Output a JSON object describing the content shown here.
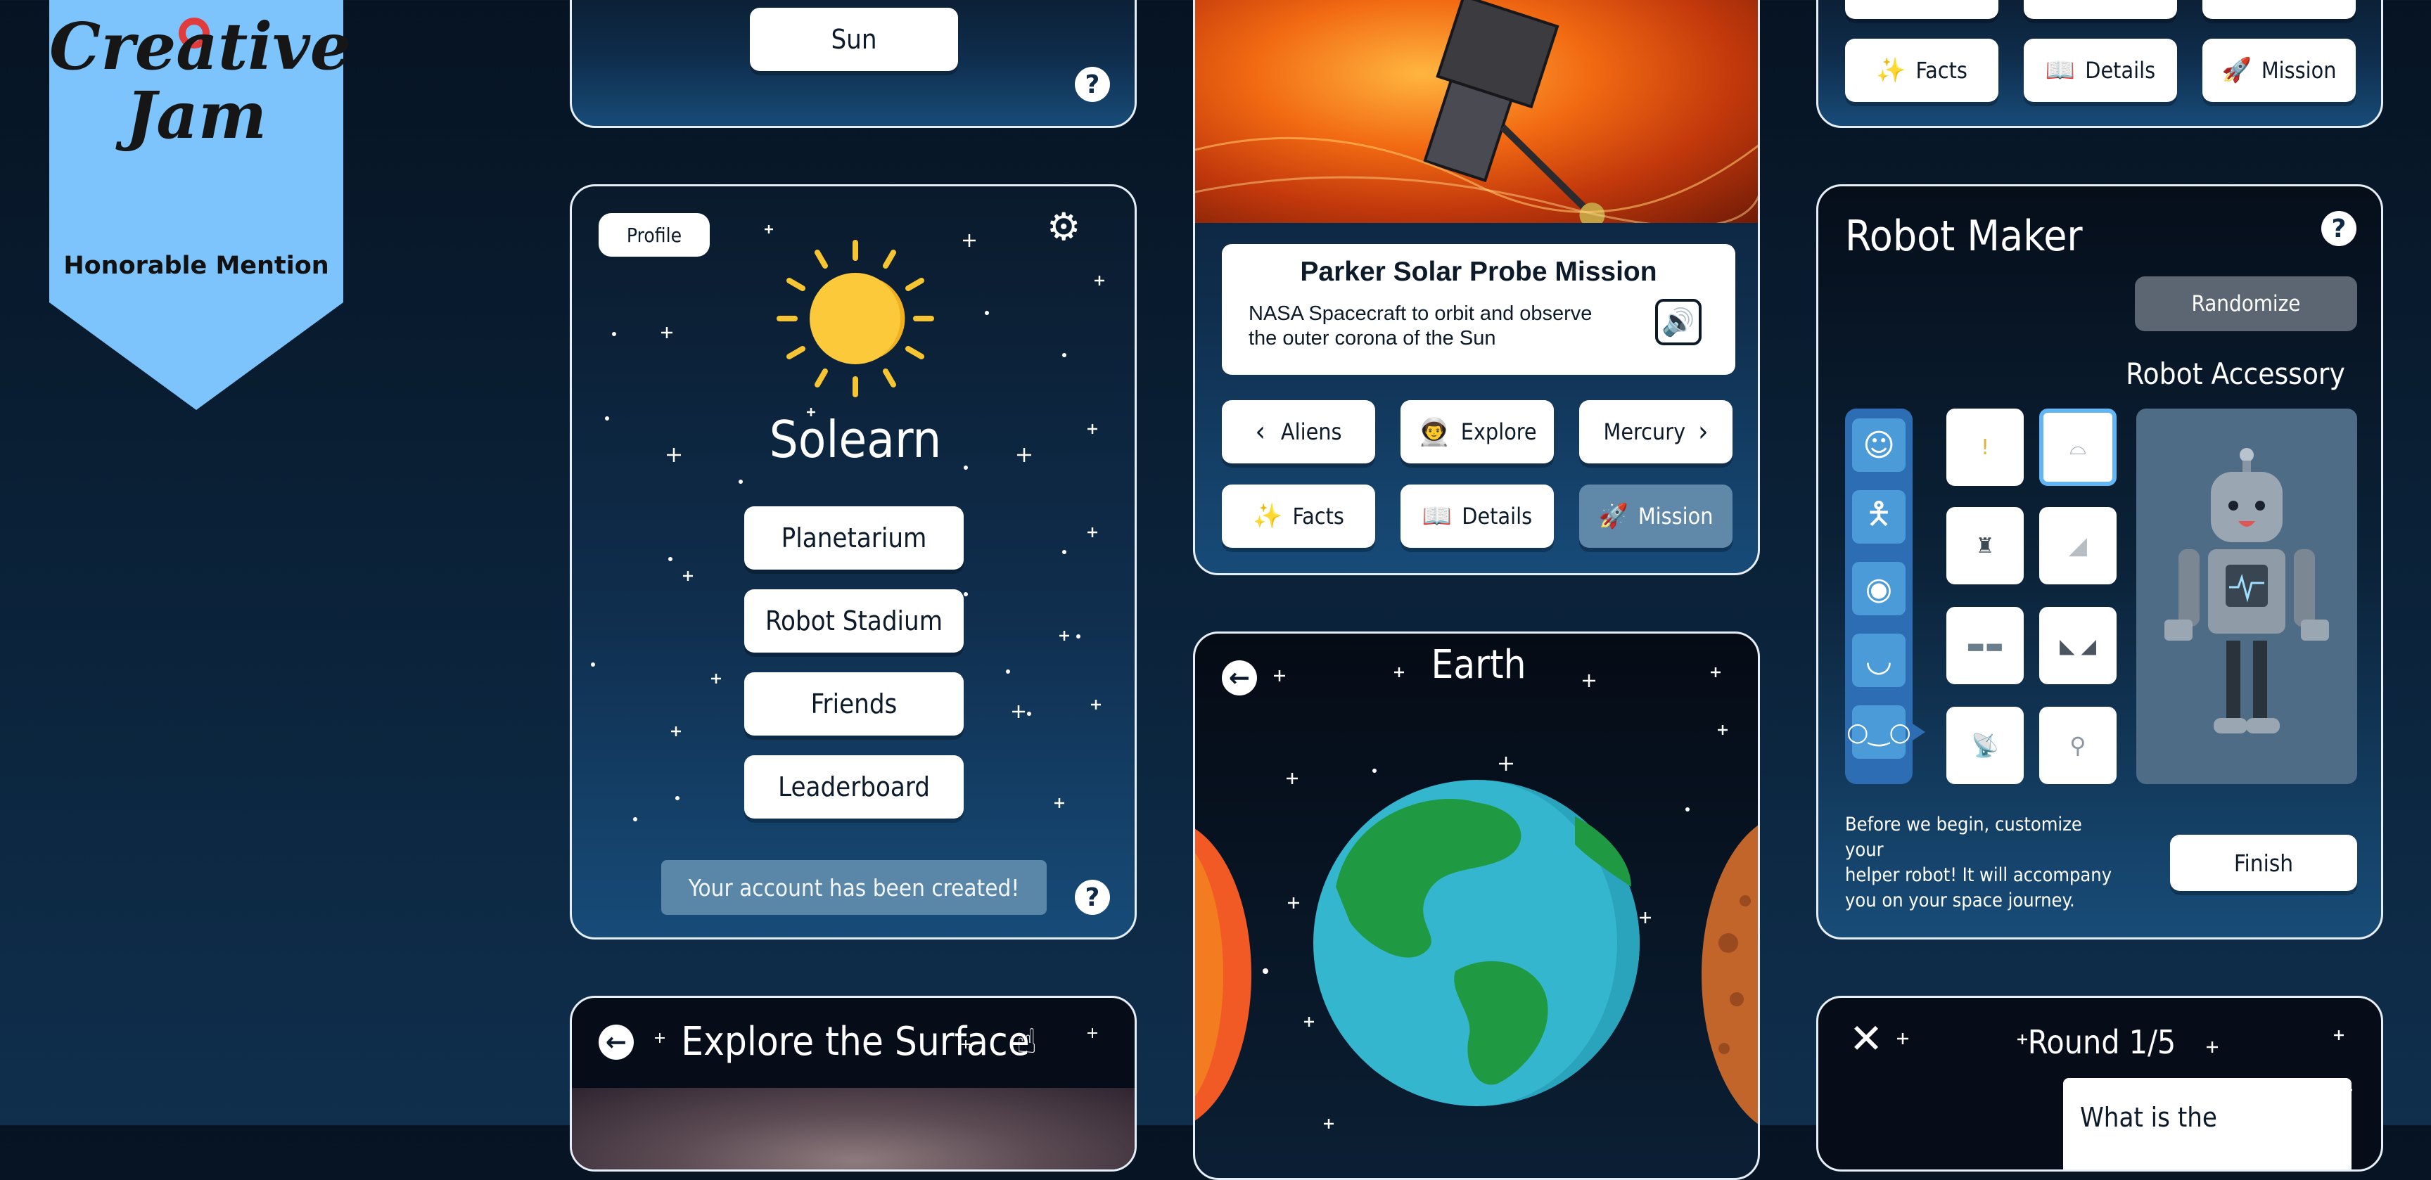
{
  "badge": {
    "logo_line1": "Creative",
    "logo_line2": "Jam",
    "award": "Honorable Mention",
    "colors": {
      "ribbon": "#7cc4fb",
      "text": "#111111"
    }
  },
  "sun_card": {
    "button_label": "Sun",
    "help_icon": "question-icon"
  },
  "home": {
    "profile_label": "Profile",
    "settings_icon": "gear-icon",
    "app_title": "Solearn",
    "menu": [
      "Planetarium",
      "Robot Stadium",
      "Friends",
      "Leaderboard"
    ],
    "toast": "Your account has been created!",
    "help_icon": "question-icon"
  },
  "surface": {
    "title": "Explore the Surface",
    "back_icon": "back-arrow-icon",
    "hand_icon": "pointer-hand-icon"
  },
  "mission": {
    "title": "Parker Solar Probe Mission",
    "description_line1": "NASA Spacecraft to orbit and observe",
    "description_line2": "the outer corona of the Sun",
    "audio_icon": "speaker-icon",
    "prev_label": "Aliens",
    "explore_label": "Explore",
    "next_label": "Mercury",
    "facts_label": "Facts",
    "details_label": "Details",
    "mission_label": "Mission"
  },
  "earth": {
    "title": "Earth",
    "back_icon": "back-arrow-icon"
  },
  "top_right": {
    "facts_label": "Facts",
    "details_label": "Details",
    "mission_label": "Mission"
  },
  "robot": {
    "title": "Robot Maker",
    "help_icon": "question-icon",
    "randomize_label": "Randomize",
    "accessory_title": "Robot Accessory",
    "categories": [
      "face-icon",
      "body-icon",
      "eye-icon",
      "mouth-icon",
      "glasses-icon"
    ],
    "intro_line1": "Before we begin, customize your",
    "intro_line2": "helper robot! It will accompany",
    "intro_line3": "you on your space journey.",
    "finish_label": "Finish"
  },
  "quiz": {
    "round_label": "Round 1/5",
    "close_icon": "close-icon",
    "question_start": "What is the"
  }
}
